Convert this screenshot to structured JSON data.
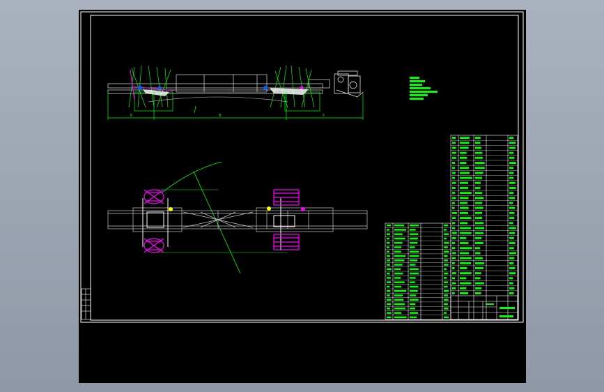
{
  "viewer": {
    "background_color": "#9aa3b1",
    "sheet_color": "#000000"
  },
  "drawing": {
    "border_color": "#ffffff",
    "line_colors": {
      "frame": "#c8c8c8",
      "dimension": "#00ff00",
      "wheels": "#ff00ff",
      "axles": "#ffffff",
      "section_line": "#00ff00"
    },
    "side_view": {
      "dimension_labels": [
        "8",
        "B",
        "5"
      ]
    },
    "notes_block": {
      "line_count": 7
    },
    "parts_table": {
      "rows_upper": 32,
      "rows_lower": 22
    },
    "title_block": {
      "row_count": 5
    }
  }
}
